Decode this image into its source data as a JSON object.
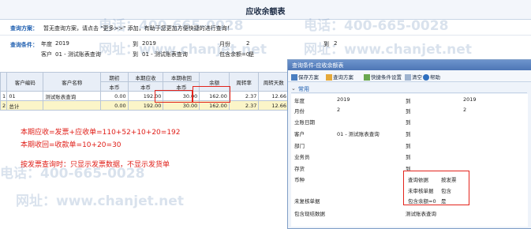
{
  "window": {
    "title": "应收余额表"
  },
  "watermark": {
    "text1": "电话：400-665-0028",
    "text2": "网址：www.chanjet.net"
  },
  "scheme": {
    "label": "查询方案：",
    "hint": "暂无查询方案，请点击 \"更多>>\" 添加，有助于您更加方便快捷的进行查询！"
  },
  "conditions": {
    "label": "查询条件：",
    "year_label": "年度",
    "year_value": "2019",
    "to_label_1": "到",
    "year_to_value": "2019",
    "month_label": "月份",
    "month_value": "2",
    "to_label_2": "到",
    "month_to_value": "2",
    "customer_label": "客户",
    "customer_value": "01 - 测试账表查询",
    "to_label_3": "到",
    "customer_to_value": "01 - 测试账表查询",
    "zero_label": "包含余额=0",
    "zero_value": "是"
  },
  "table": {
    "headers": [
      "客户编码",
      "客户名称",
      "期初",
      "本期应收",
      "本期收回",
      "余额",
      "周转率",
      "周转天数"
    ],
    "subheaders": [
      "本币",
      "本币",
      "本币",
      "本币"
    ],
    "rows": [
      {
        "idx": "1",
        "code": "01",
        "name": "测试账表查询",
        "opening": "0.00",
        "receivable": "192.00",
        "received": "30.00",
        "balance": "162.00",
        "turnover": "2.37",
        "days": "12.66"
      },
      {
        "idx": "2",
        "code": "总计",
        "name": "",
        "opening": "0.00",
        "receivable": "192.00",
        "received": "30.00",
        "balance": "162.00",
        "turnover": "2.37",
        "days": "12.66"
      }
    ]
  },
  "notes": {
    "line1": "本期应收=发票+应收单=110+52+10+20=192",
    "line2": "本期收回=收款单=10+20=30",
    "line3": "按发票查询时：只显示发票数据，不显示发货单"
  },
  "dialog": {
    "title": "查询条件-应收余额表",
    "toolbar": [
      "保存方案",
      "查询方案",
      "快捷条件设置",
      "清空",
      "帮助"
    ],
    "section": "常用",
    "fields": [
      {
        "label": "年度",
        "value": "2019",
        "to": "到",
        "to_value": "2019"
      },
      {
        "label": "月份",
        "value": "2",
        "to": "到",
        "to_value": "2"
      },
      {
        "label": "立账日期",
        "value": "",
        "to": "到",
        "to_value": ""
      },
      {
        "label": "客户",
        "value": "01 - 测试账表查询",
        "to": "到",
        "to_value": ""
      },
      {
        "label": "部门",
        "value": "",
        "to": "到",
        "to_value": ""
      },
      {
        "label": "业务员",
        "value": "",
        "to": "到",
        "to_value": ""
      },
      {
        "label": "存货",
        "value": "",
        "to": "到",
        "to_value": ""
      }
    ],
    "currency_label": "币种",
    "query_basis_label": "查询依据",
    "query_basis_value": "按发票",
    "unaudited_label": "未审核单据",
    "unaudited_value": "包含",
    "zero_label": "包含余额=0",
    "zero_value": "是",
    "unrecorded_label": "未复核单据",
    "sum_label": "包含现结数据",
    "last_label": "测试账表查询"
  }
}
